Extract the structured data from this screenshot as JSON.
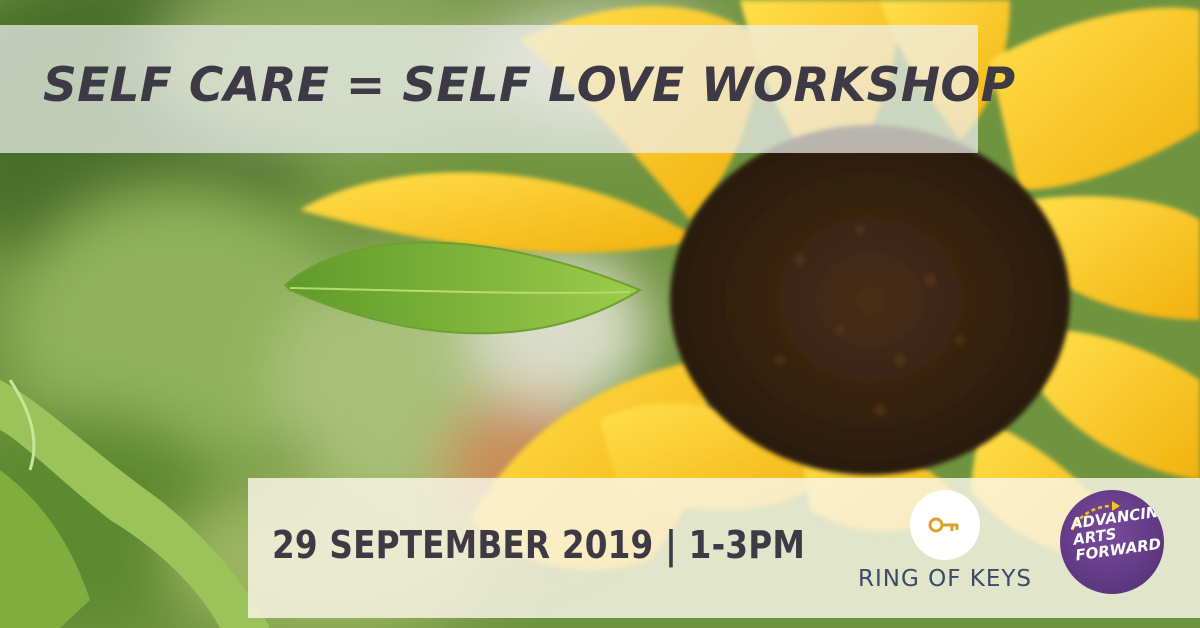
{
  "header": {
    "title": "SELF CARE = SELF LOVE WORKSHOP"
  },
  "event": {
    "date_time": "29 SEPTEMBER 2019 | 1-3PM"
  },
  "logos": {
    "ring_of_keys": {
      "name": "RING OF KEYS",
      "icon": "key-icon",
      "color": "#d9a32a"
    },
    "advancing_arts_forward": {
      "lines": [
        "ADVANCING",
        "ARTS",
        "FORWARD"
      ],
      "color": "#5d3680"
    }
  },
  "colors": {
    "text_dark": "#3d3a46",
    "sunflower_petal": "#f5c518",
    "sunflower_center": "#3a2414",
    "leaf_green": "#7fb03a"
  }
}
